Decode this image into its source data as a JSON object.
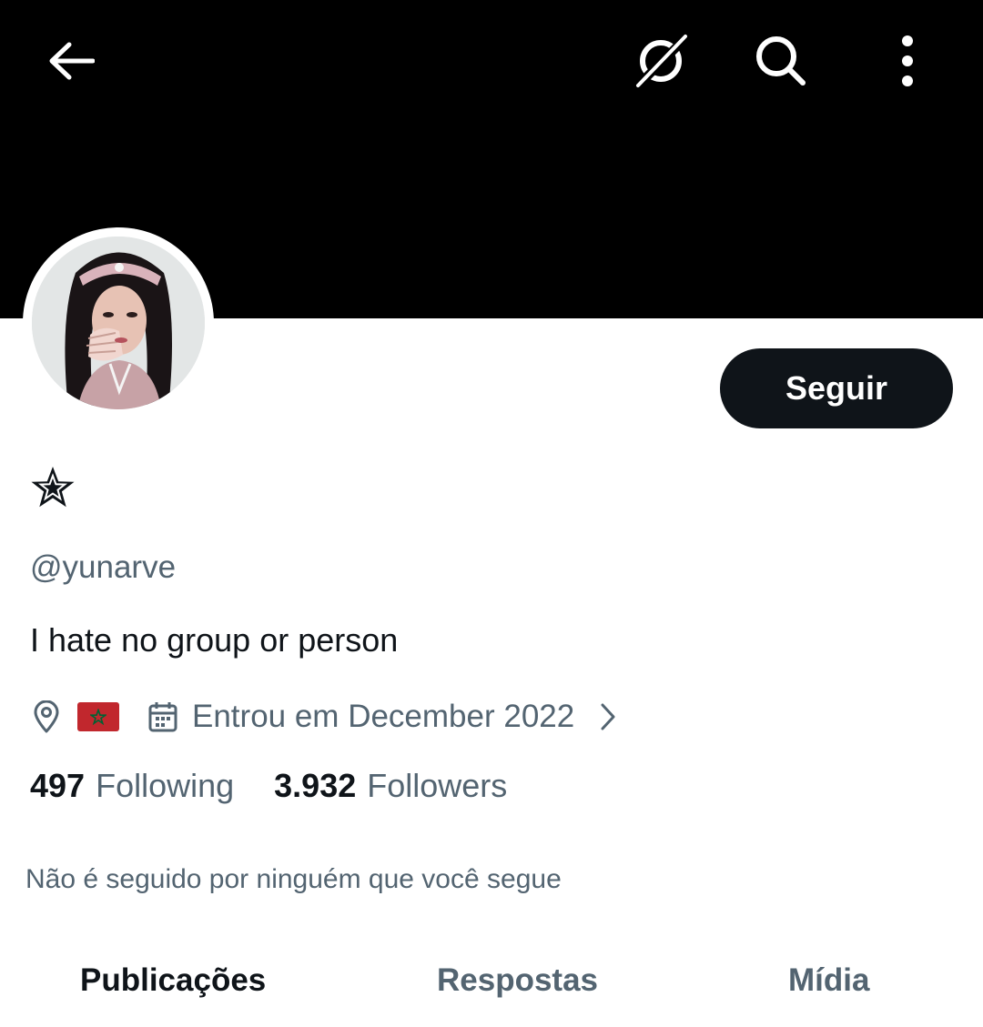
{
  "header": {
    "icons": [
      "back-arrow-icon",
      "grok-icon",
      "search-icon",
      "more-vertical-icon"
    ]
  },
  "profile": {
    "display_name_icon": "star-icon",
    "handle": "@yunarve",
    "bio": "I hate no group or person",
    "location_icon": "location-pin-icon",
    "location_flag": "morocco-flag",
    "joined": "Entrou em December 2022",
    "following_count": "497",
    "following_label": "Following",
    "followers_count": "3.932",
    "followers_label": "Followers",
    "followed_by": "Não é seguido por ninguém que você segue"
  },
  "actions": {
    "follow_label": "Seguir"
  },
  "tabs": [
    {
      "label": "Publicações",
      "active": true
    },
    {
      "label": "Respostas",
      "active": false
    },
    {
      "label": "Mídia",
      "active": false
    }
  ],
  "colors": {
    "banner": "#000000",
    "primary_text": "#0f1419",
    "secondary_text": "#536471",
    "follow_button": "#0f1419"
  }
}
